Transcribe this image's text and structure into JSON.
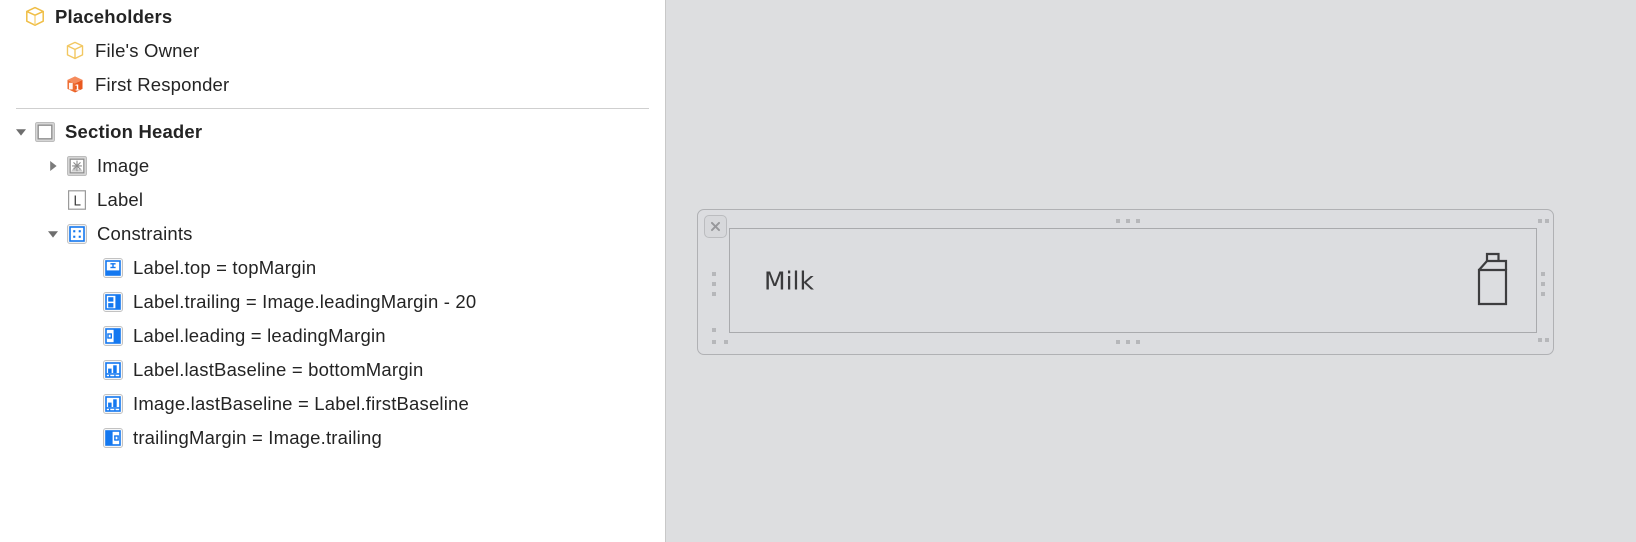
{
  "outline": {
    "placeholders": {
      "label": "Placeholders",
      "icon": "cube-outline-icon",
      "children": [
        {
          "label": "File's Owner",
          "icon": "cube-outline-icon"
        },
        {
          "label": "First Responder",
          "icon": "first-responder-cube-icon"
        }
      ]
    },
    "scene": {
      "label": "Section Header",
      "icon": "view-square-icon",
      "children": [
        {
          "label": "Image",
          "icon": "image-view-icon"
        },
        {
          "label": "Label",
          "icon": "label-l-icon"
        }
      ],
      "constraints_group": {
        "label": "Constraints",
        "icon": "constraints-icon",
        "items": [
          {
            "label": "Label.top = topMargin",
            "icon": "constraint-top-icon"
          },
          {
            "label": "Label.trailing = Image.leadingMargin - 20",
            "icon": "constraint-trailing-icon"
          },
          {
            "label": "Label.leading = leadingMargin",
            "icon": "constraint-leading-icon"
          },
          {
            "label": "Label.lastBaseline = bottomMargin",
            "icon": "constraint-baseline-icon"
          },
          {
            "label": "Image.lastBaseline = Label.firstBaseline",
            "icon": "constraint-baseline-icon"
          },
          {
            "label": "trailingMargin = Image.trailing",
            "icon": "constraint-trailing-margin-icon"
          }
        ]
      }
    }
  },
  "canvas": {
    "cell_text": "Milk",
    "accessory_icon": "milk-carton-icon",
    "close_icon": "close-x-icon"
  },
  "colors": {
    "placeholder_cube": "#F5C14E",
    "first_responder": "#F2713B",
    "constraint_blue": "#1478F0",
    "canvas_background": "#DDDEE0",
    "text": "#242424"
  }
}
